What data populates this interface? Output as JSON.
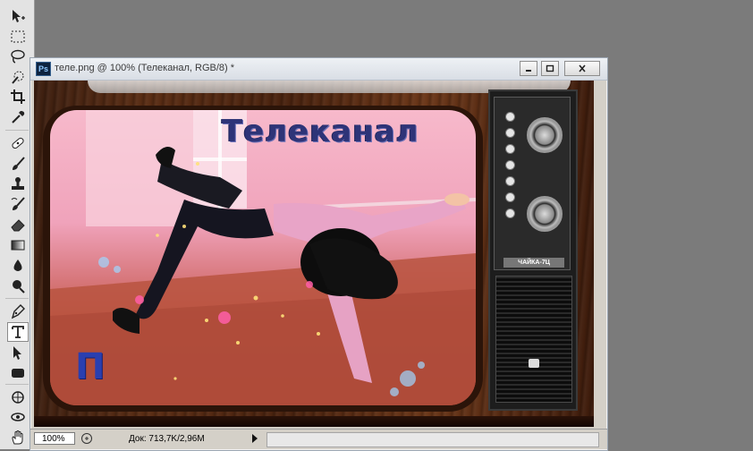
{
  "app": {
    "toolbox": [
      {
        "name": "move-tool",
        "icon": "move-icon"
      },
      {
        "name": "marquee-tool",
        "icon": "rect-marquee-icon"
      },
      {
        "name": "lasso-tool",
        "icon": "lasso-icon"
      },
      {
        "name": "quick-selection-tool",
        "icon": "quick-select-icon"
      },
      {
        "name": "crop-tool",
        "icon": "crop-icon"
      },
      {
        "name": "eyedropper-tool",
        "icon": "eyedropper-icon"
      },
      {
        "name": "healing-brush-tool",
        "icon": "bandage-icon"
      },
      {
        "name": "brush-tool",
        "icon": "brush-icon"
      },
      {
        "name": "clone-stamp-tool",
        "icon": "stamp-icon"
      },
      {
        "name": "history-brush-tool",
        "icon": "history-brush-icon"
      },
      {
        "name": "eraser-tool",
        "icon": "eraser-icon"
      },
      {
        "name": "gradient-tool",
        "icon": "gradient-icon"
      },
      {
        "name": "blur-tool",
        "icon": "drop-icon"
      },
      {
        "name": "dodge-tool",
        "icon": "dodge-icon"
      },
      {
        "name": "pen-tool",
        "icon": "pen-icon"
      },
      {
        "name": "type-tool",
        "icon": "type-icon",
        "active": true
      },
      {
        "name": "path-selection-tool",
        "icon": "arrow-icon"
      },
      {
        "name": "shape-tool",
        "icon": "rounded-rect-icon"
      },
      {
        "name": "3d-rotate-tool",
        "icon": "3d-rotate-icon"
      },
      {
        "name": "3d-orbit-tool",
        "icon": "3d-orbit-icon"
      },
      {
        "name": "hand-tool",
        "icon": "hand-icon"
      }
    ]
  },
  "document": {
    "title": "теле.png @ 100% (Телеканал, RGB/8) *",
    "app_badge": "Ps",
    "canvas": {
      "channel_title": "Телеканал",
      "channel_logo": "П",
      "tv_brand": "ЧАЙКА-7Ц"
    },
    "status": {
      "zoom": "100%",
      "doc_info": "Док: 713,7K/2,96M"
    }
  },
  "colors": {
    "workspace": "#7b7b7b",
    "title_text": "#2e3478",
    "logo_text": "#2a3fb0"
  }
}
